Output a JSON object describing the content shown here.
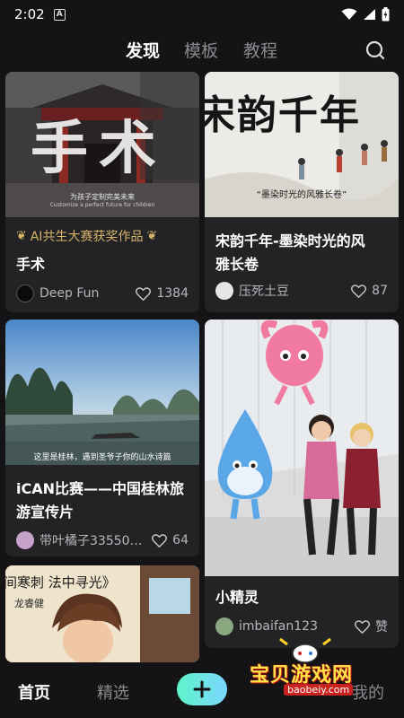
{
  "status": {
    "time": "2:02",
    "badge": "A"
  },
  "topnav": {
    "tabs": [
      "发现",
      "模板",
      "教程"
    ],
    "active_index": 0
  },
  "cards": [
    {
      "image_text_big": "手术",
      "image_caption": "为孩子定制完美未来",
      "image_caption_en": "Customize a perfect future for children",
      "award": "AI共生大赛获奖作品",
      "title": "手术",
      "user": "Deep Fun",
      "likes": "1384"
    },
    {
      "image_text_big": "宋韵千年",
      "image_caption": "“墨染时光的风雅长卷”",
      "title_line1": "宋韵千年-墨染时光的风",
      "title_line2": "雅长卷",
      "user": "压死土豆",
      "likes": "87"
    },
    {
      "image_caption": "这里是桂林，遇到圣爷子你的山水诗篇",
      "title_line1": "iCAN比赛——中国桂林旅",
      "title_line2": "游宣传片",
      "user": "带叶橘子335503...",
      "likes": "64"
    },
    {
      "title": "小精灵",
      "user": "imbaifan123",
      "likes": "赞"
    },
    {
      "image_caption": "间寒刺 法中寻光》",
      "image_sub": "龙睿健"
    }
  ],
  "bottomnav": {
    "items": [
      "首页",
      "精选",
      "我的"
    ],
    "active_index": 0
  },
  "watermark": {
    "text": "宝贝游戏网",
    "url": "baobeiy.com"
  },
  "colors": {
    "background": "#141416",
    "card": "#232326",
    "award": "#d8b46a",
    "accent_start": "#5ff2c8",
    "accent_end": "#7ad8ff"
  }
}
